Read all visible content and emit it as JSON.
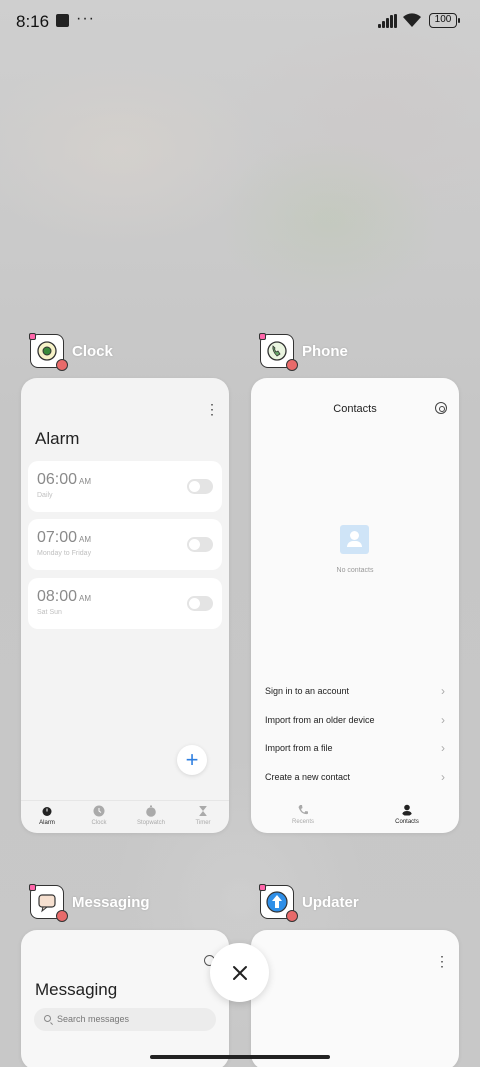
{
  "status_bar": {
    "time": "8:16",
    "more": "···",
    "battery": "100"
  },
  "apps": {
    "clock": {
      "name": "Clock",
      "screen_title": "Alarm",
      "alarms": [
        {
          "time": "06:00",
          "ampm": "AM",
          "repeat": "Daily"
        },
        {
          "time": "07:00",
          "ampm": "AM",
          "repeat": "Monday to Friday"
        },
        {
          "time": "08:00",
          "ampm": "AM",
          "repeat": "Sat Sun"
        }
      ],
      "fab": "+",
      "nav": [
        "Alarm",
        "Clock",
        "Stopwatch",
        "Timer"
      ]
    },
    "phone": {
      "name": "Phone",
      "screen_title": "Contacts",
      "empty_text": "No contacts",
      "options": [
        "Sign in to an account",
        "Import from an older device",
        "Import from a file",
        "Create a new contact"
      ],
      "nav": [
        "Recents",
        "Contacts"
      ]
    },
    "messaging": {
      "name": "Messaging",
      "screen_title": "Messaging",
      "search_placeholder": "Search messages"
    },
    "updater": {
      "name": "Updater"
    }
  },
  "colors": {
    "accent": "#2f7fe0",
    "text": "#222222"
  }
}
